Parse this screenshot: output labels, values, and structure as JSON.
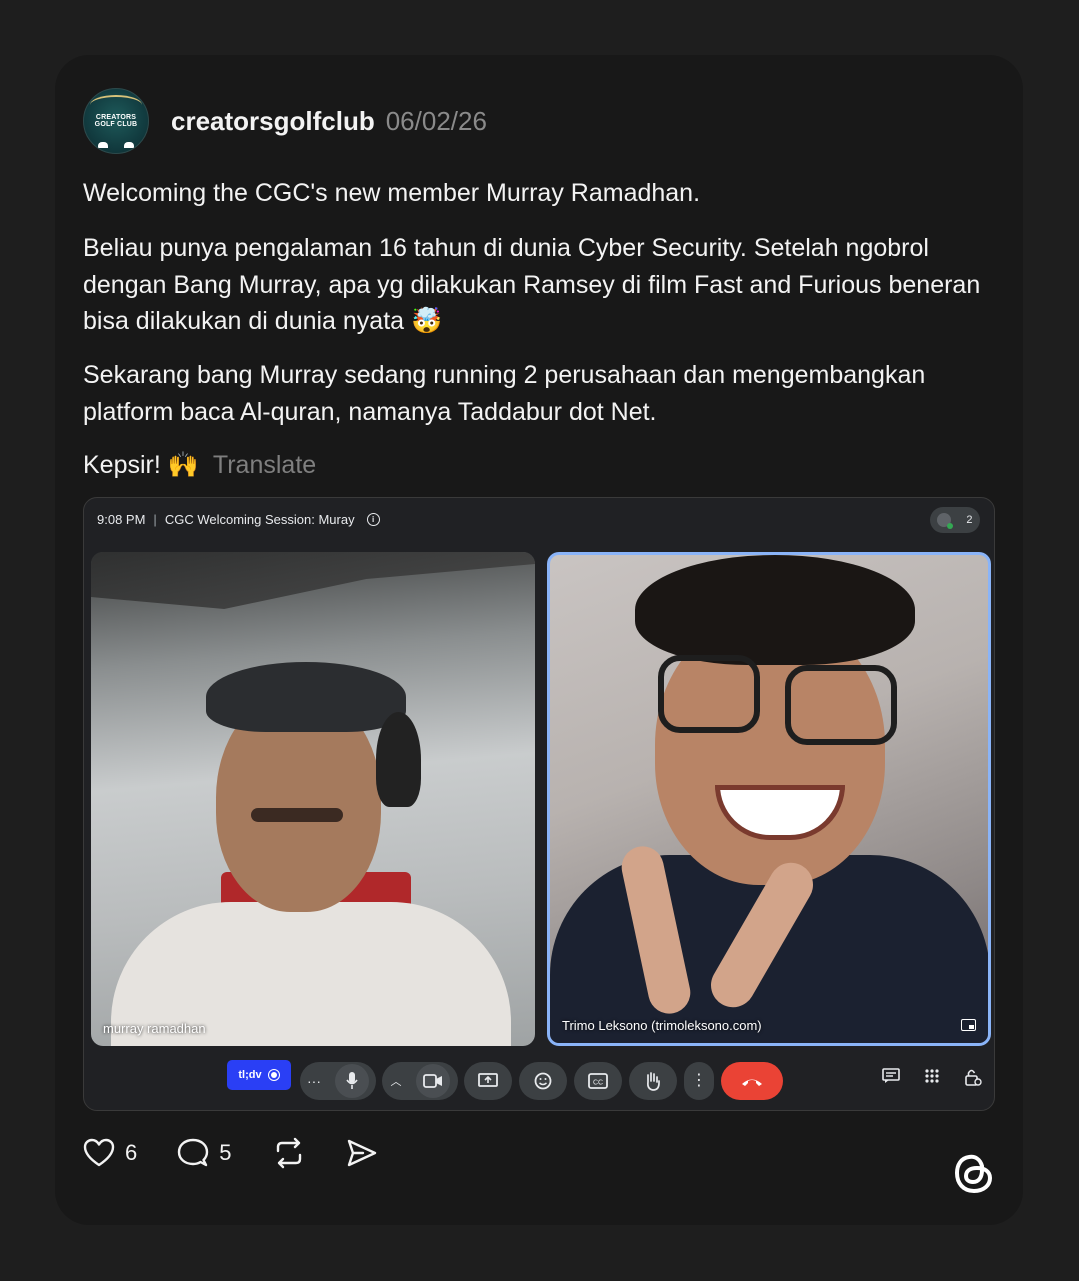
{
  "post": {
    "username": "creatorsgolfclub",
    "date": "06/02/26",
    "avatar_text_line1": "CREATORS",
    "avatar_text_line2": "GOLF CLUB",
    "paragraph1": "Welcoming the CGC's new member Murray Ramadhan.",
    "paragraph2": "Beliau punya pengalaman 16 tahun di dunia Cyber Security. Setelah ngobrol dengan Bang Murray, apa yg dilakukan Ramsey di film Fast and Furious beneran bisa dilakukan di dunia nyata 🤯",
    "paragraph3": "Sekarang bang Murray sedang running 2 perusahaan dan mengembangkan platform baca Al-quran, namanya Taddabur dot Net.",
    "paragraph4": "Kepsir! 🙌",
    "translate_label": "Translate"
  },
  "meeting": {
    "time": "9:08 PM",
    "title": "CGC Welcoming Session: Muray",
    "participant_count": "2",
    "participant_left_name": "murray ramadhan",
    "participant_right_name": "Trimo Leksono (trimoleksono.com)",
    "tldv_label": "tl;dv",
    "more_label": "···",
    "accent_end_call": "#ea4335",
    "accent_speaking": "#8ab4f8"
  },
  "actions": {
    "likes": "6",
    "replies": "5"
  },
  "icons": [
    "heart-icon",
    "comment-icon",
    "repost-icon",
    "share-icon",
    "threads-logo"
  ]
}
